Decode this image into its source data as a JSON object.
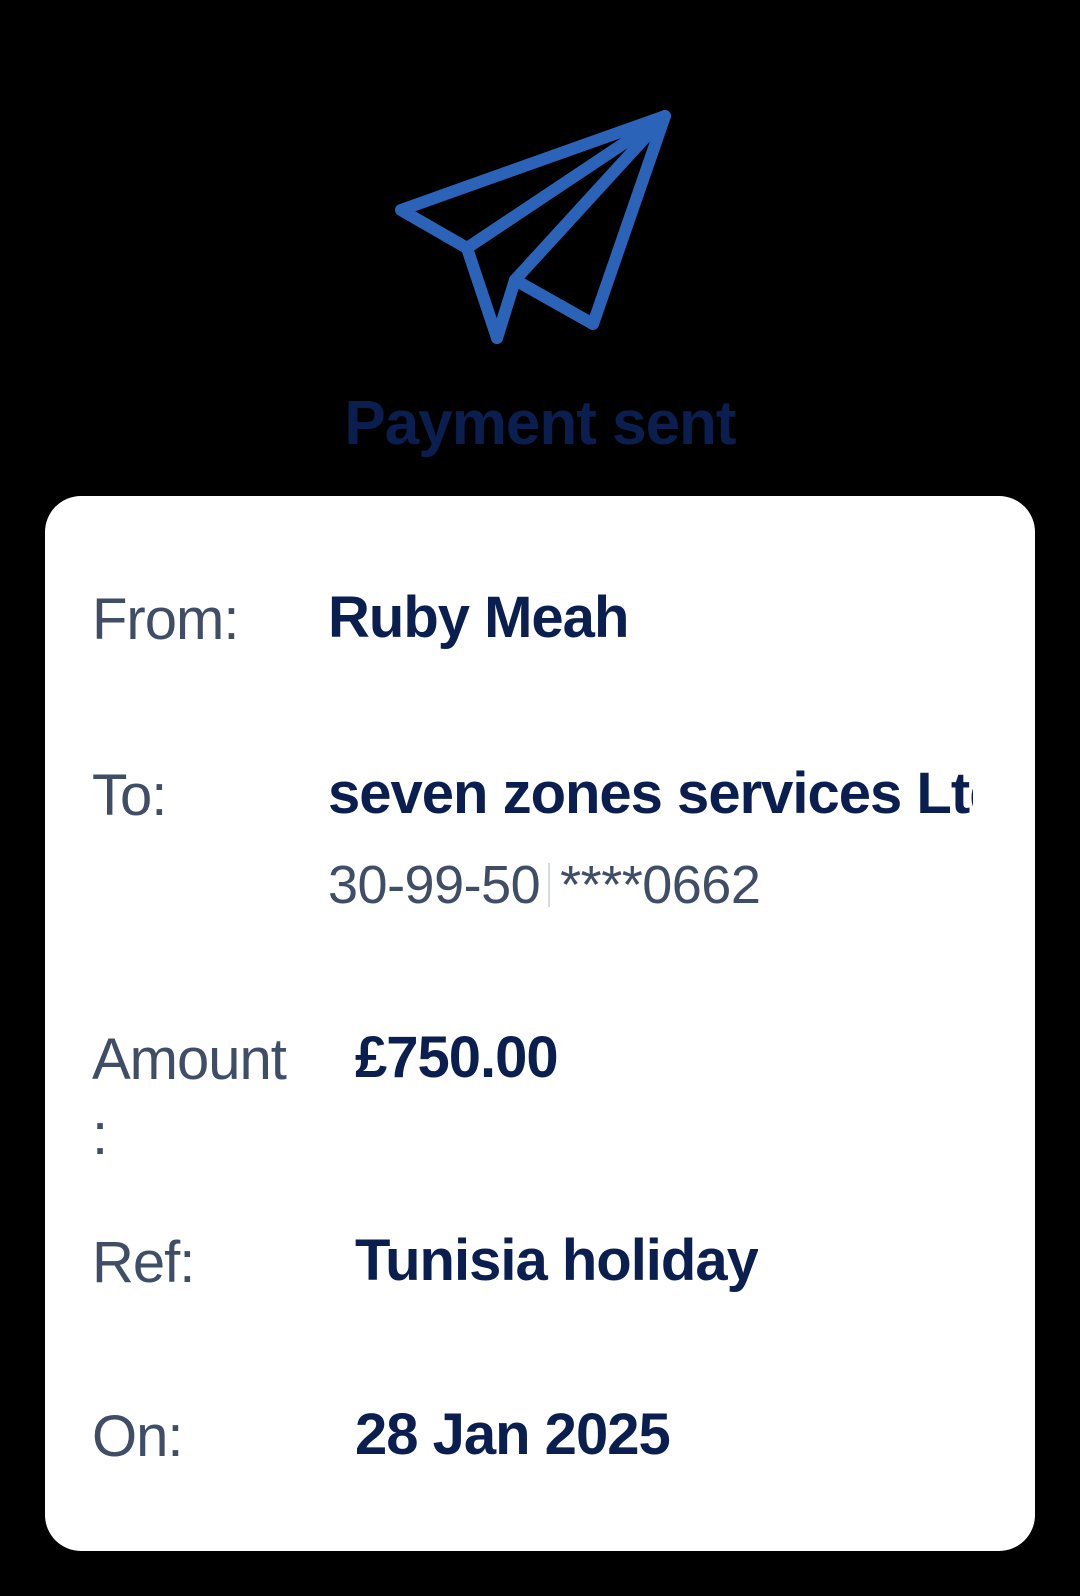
{
  "title": "Payment sent",
  "icon": "paper-plane-icon",
  "colors": {
    "icon": "#2a63b8",
    "title": "#0a1f4f",
    "label": "#3f4d66",
    "value": "#0a1f4f",
    "background": "#000000",
    "card": "#ffffff"
  },
  "details": {
    "from_label": "From:",
    "from_value": "Ruby Meah",
    "to_label": "To:",
    "to_value": "seven zones services Ltd",
    "sort_code": "30-99-50",
    "account_number": "****0662",
    "amount_label_line1": "Amount",
    "amount_label_line2": ":",
    "amount_value": "£750.00",
    "ref_label": "Ref:",
    "ref_value": "Tunisia holiday",
    "on_label": "On:",
    "on_value": "28 Jan 2025"
  }
}
